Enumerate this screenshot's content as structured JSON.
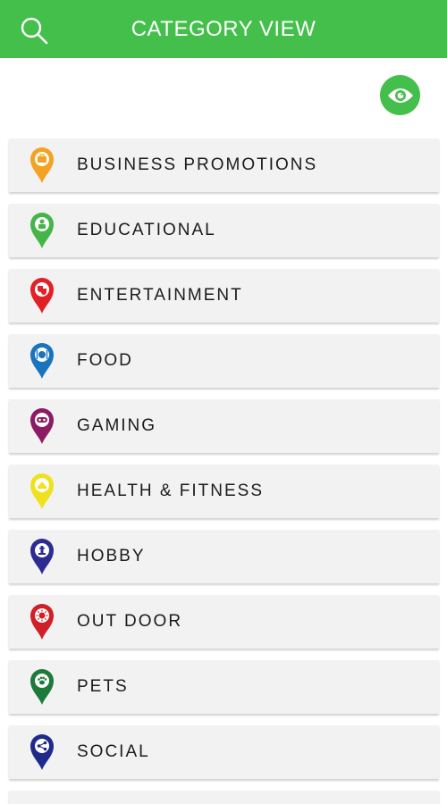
{
  "header": {
    "title": "CATEGORY VIEW",
    "accent_color": "#44bf4b",
    "search_icon": "search-icon"
  },
  "view_toggle": {
    "icon": "eye-icon"
  },
  "categories": [
    {
      "label": "BUSINESS PROMOTIONS",
      "icon": "briefcase-pin-icon",
      "color": "#f3a323"
    },
    {
      "label": "EDUCATIONAL",
      "icon": "teacher-pin-icon",
      "color": "#46b549"
    },
    {
      "label": "ENTERTAINMENT",
      "icon": "theater-masks-pin-icon",
      "color": "#e22027"
    },
    {
      "label": "FOOD",
      "icon": "plate-cutlery-pin-icon",
      "color": "#1a73bd"
    },
    {
      "label": "GAMING",
      "icon": "game-mask-pin-icon",
      "color": "#8c1a64"
    },
    {
      "label": "HEALTH & FITNESS",
      "icon": "health-pin-icon",
      "color": "#f0e11f"
    },
    {
      "label": "HOBBY",
      "icon": "chess-piece-pin-icon",
      "color": "#2d2c91"
    },
    {
      "label": "OUT DOOR",
      "icon": "sun-pin-icon",
      "color": "#cf2027"
    },
    {
      "label": "PETS",
      "icon": "paw-pin-icon",
      "color": "#1d7a3a"
    },
    {
      "label": "SOCIAL",
      "icon": "share-pin-icon",
      "color": "#1f2a8c"
    }
  ]
}
